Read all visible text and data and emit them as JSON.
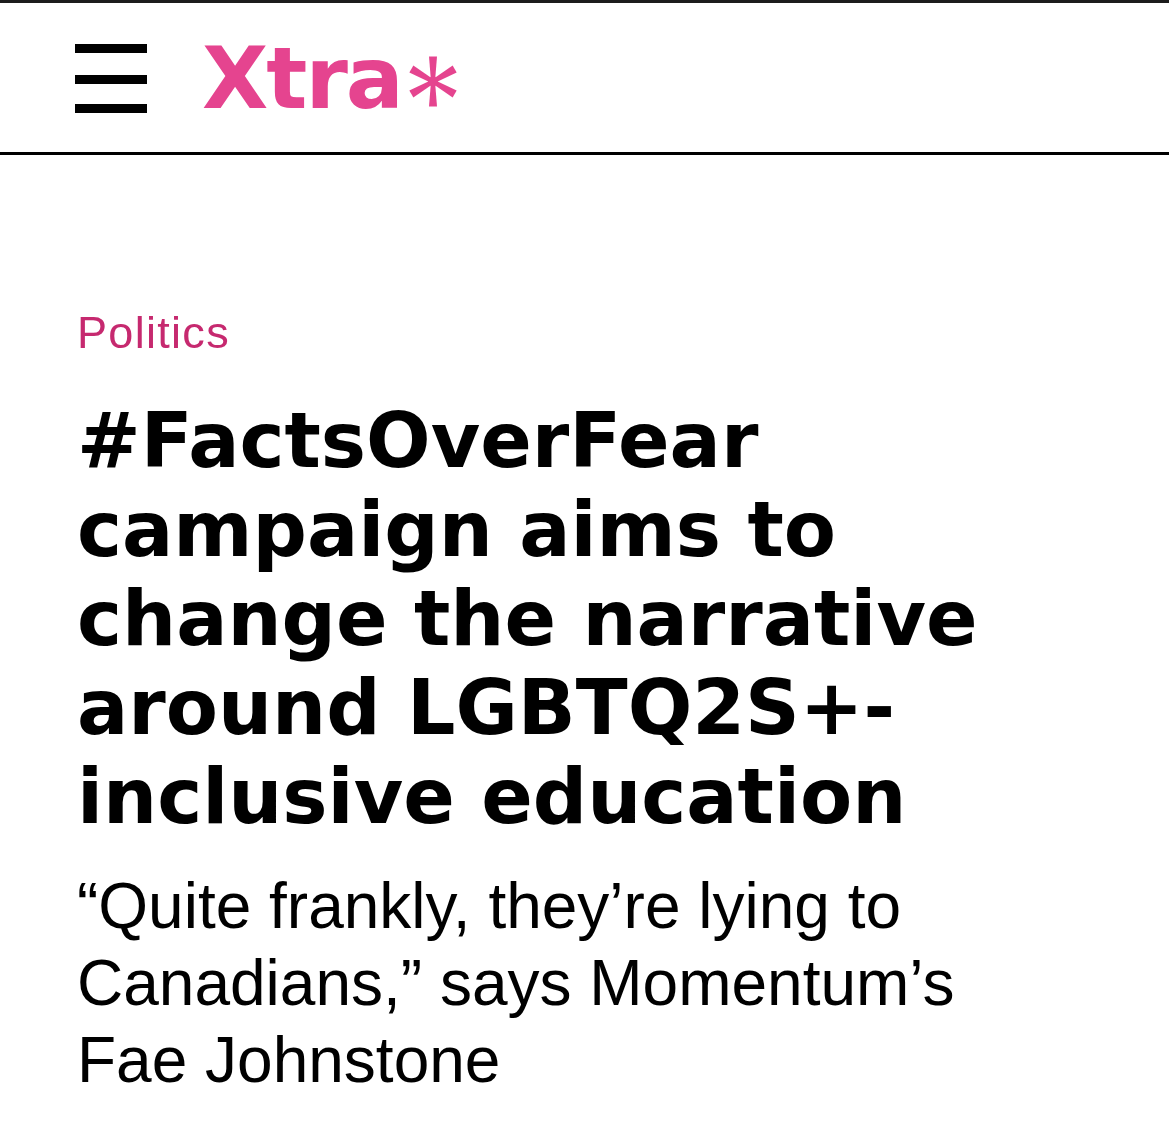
{
  "header": {
    "logo": "Xtra"
  },
  "article": {
    "category": "Politics",
    "headline": "#FactsOverFear campaign aims to change the narrative around LGBTQ2S+-inclusive education",
    "deck": "“Quite frankly, they’re lying to Canadians,” says Momentum’s Fae Johnstone"
  }
}
